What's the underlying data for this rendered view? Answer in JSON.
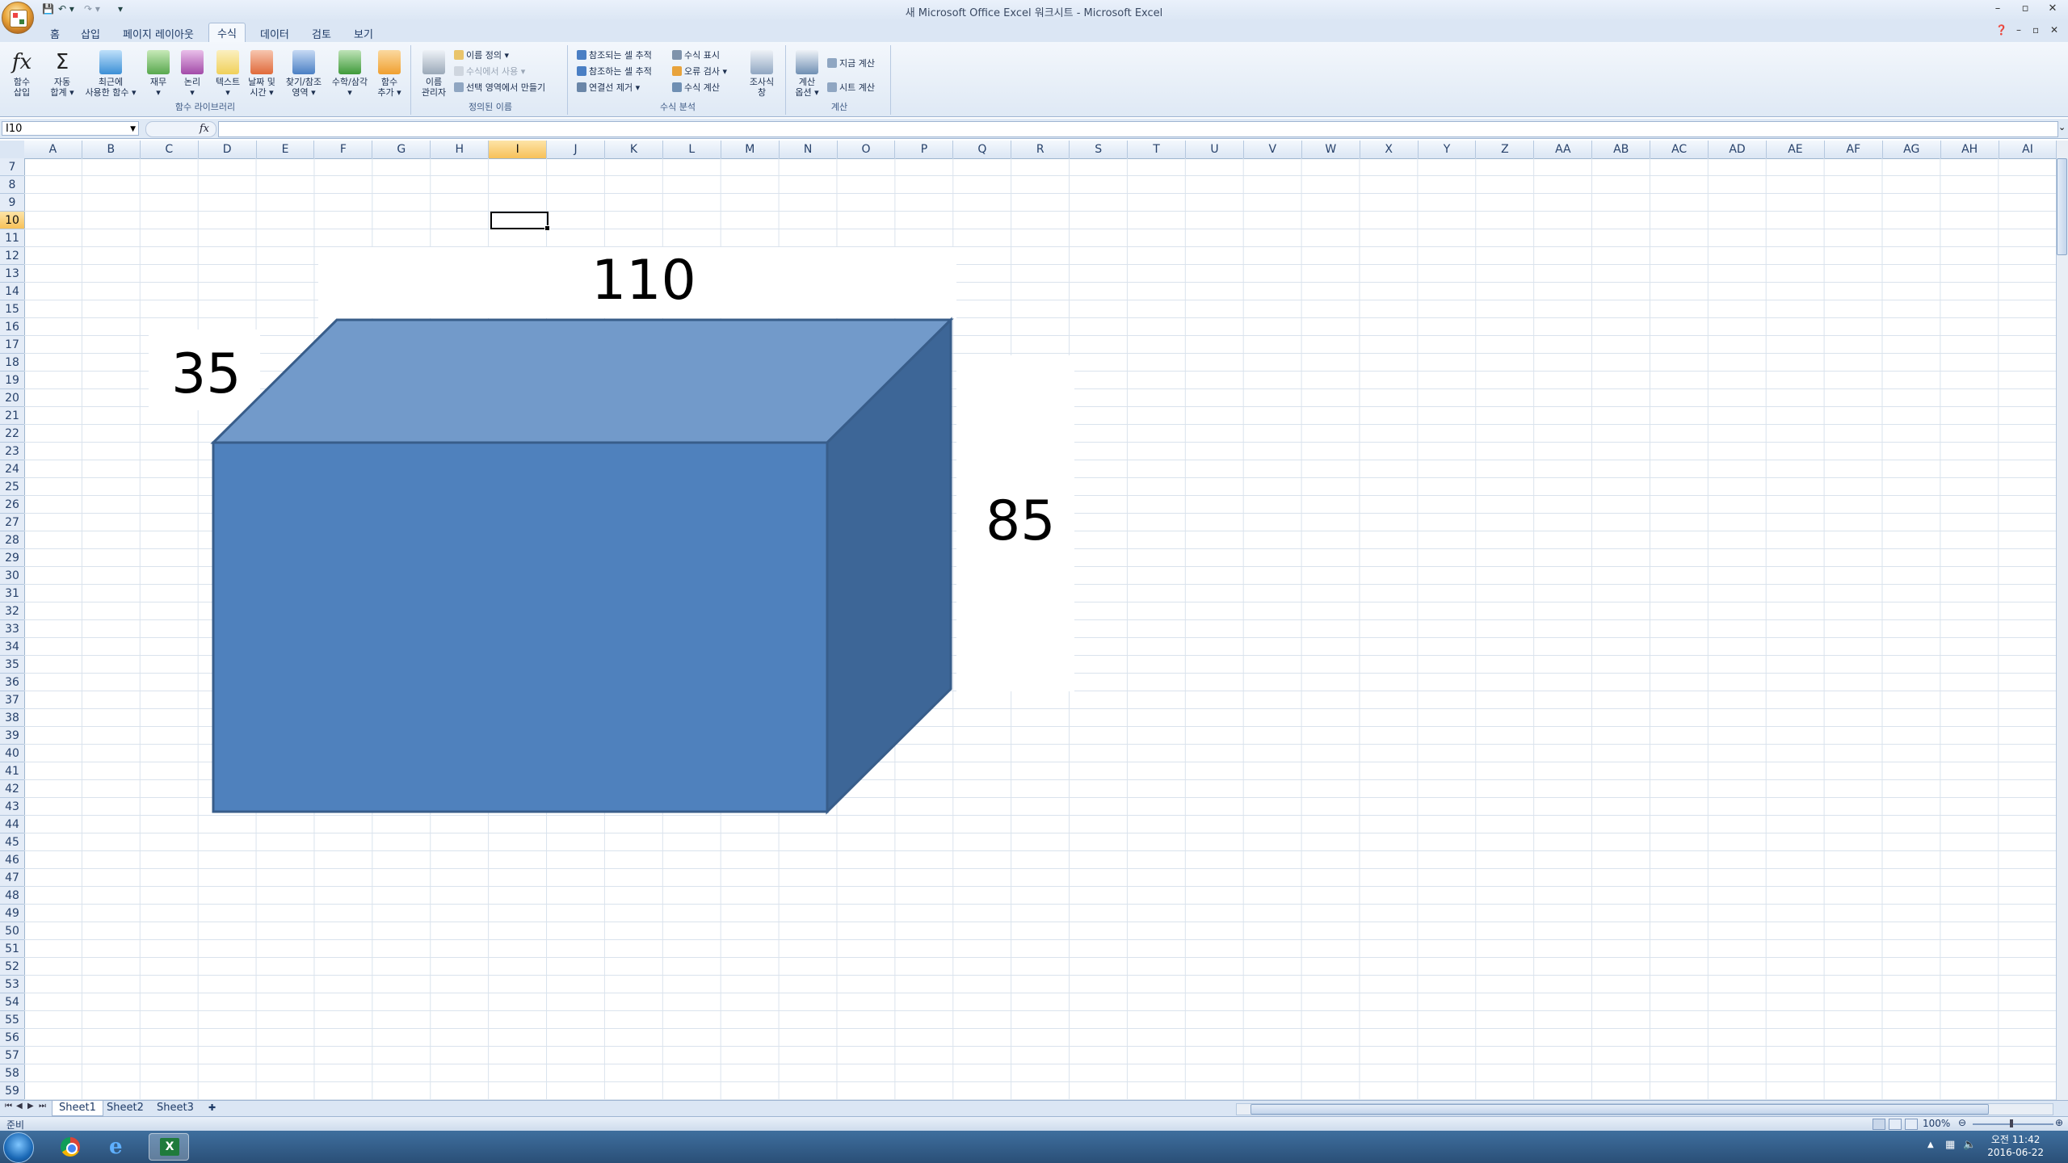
{
  "window": {
    "title": "새 Microsoft Office Excel 워크시트 - Microsoft Excel",
    "controls": [
      "–",
      "▫",
      "✕"
    ]
  },
  "qat": {
    "save": "💾",
    "undo": "↶ ▾",
    "redo": "↷ ▾",
    "customize": "▾"
  },
  "tabs": [
    "홈",
    "삽입",
    "페이지 레이아웃",
    "수식",
    "데이터",
    "검토",
    "보기"
  ],
  "active_tab": "수식",
  "ribbon": {
    "function_library": {
      "label": "함수 라이브러리",
      "buttons": [
        {
          "name": "insert-function",
          "label1": "함수",
          "label2": "삽입",
          "color": "#ffffff"
        },
        {
          "name": "autosum",
          "label1": "자동",
          "label2": "합계 ▾",
          "color": "#ffffff"
        },
        {
          "name": "recently-used",
          "label1": "최근에",
          "label2": "사용한 함수 ▾",
          "color": "#3b8fd6"
        },
        {
          "name": "financial",
          "label1": "재무",
          "label2": "▾",
          "color": "#58a84e"
        },
        {
          "name": "logical",
          "label1": "논리",
          "label2": "▾",
          "color": "#a24aa8"
        },
        {
          "name": "text",
          "label1": "텍스트",
          "label2": "▾",
          "color": "#f0d05a"
        },
        {
          "name": "date-time",
          "label1": "날짜 및",
          "label2": "시간 ▾",
          "color": "#e06a3a"
        },
        {
          "name": "lookup",
          "label1": "찾기/참조",
          "label2": "영역 ▾",
          "color": "#4a7fc4"
        },
        {
          "name": "math-trig",
          "label1": "수학/삼각",
          "label2": "▾",
          "color": "#3f9a3a"
        },
        {
          "name": "more-functions",
          "label1": "함수",
          "label2": "추가 ▾",
          "color": "#f0a030"
        }
      ]
    },
    "defined_names": {
      "label": "정의된 이름",
      "manager": {
        "label1": "이름",
        "label2": "관리자"
      },
      "define_name": "이름 정의 ▾",
      "use_in_formula": "수식에서 사용 ▾",
      "create_from_selection": "선택 영역에서 만들기"
    },
    "formula_auditing": {
      "label": "수식 분석",
      "trace_precedents": "참조되는 셀 추적",
      "trace_dependents": "참조하는 셀 추적",
      "remove_arrows": "연결선 제거 ▾",
      "show_formulas": "수식 표시",
      "error_checking": "오류 검사 ▾",
      "evaluate_formula": "수식 계산",
      "watch_window": {
        "label1": "조사식",
        "label2": "창"
      }
    },
    "calculation": {
      "label": "계산",
      "options": {
        "label1": "계산",
        "label2": "옵션 ▾"
      },
      "calc_now": "지금 계산",
      "calc_sheet": "시트 계산"
    }
  },
  "formula_bar": {
    "name_box": "I10",
    "fx": "fx",
    "content": ""
  },
  "columns": [
    "A",
    "B",
    "C",
    "D",
    "E",
    "F",
    "G",
    "H",
    "I",
    "J",
    "K",
    "L",
    "M",
    "N",
    "O",
    "P",
    "Q",
    "R",
    "S",
    "T",
    "U",
    "V",
    "W",
    "X",
    "Y",
    "Z",
    "AA",
    "AB",
    "AC",
    "AD",
    "AE",
    "AF",
    "AG",
    "AH",
    "AI"
  ],
  "selected_column": "I",
  "rows_start": 7,
  "rows_end": 59,
  "selected_row": 10,
  "shapes": {
    "box_face_color": "#4f81bd",
    "box_top_color": "#729aca",
    "box_side_color": "#3d6697",
    "box_border_color": "#385d8a",
    "label_top": "110",
    "label_left": "35",
    "label_right": "85"
  },
  "sheets": [
    "Sheet1",
    "Sheet2",
    "Sheet3"
  ],
  "active_sheet": "Sheet1",
  "status": {
    "ready": "준비",
    "zoom": "100%"
  },
  "taskbar": {
    "time": "오전 11:42",
    "date": "2016-06-22"
  }
}
